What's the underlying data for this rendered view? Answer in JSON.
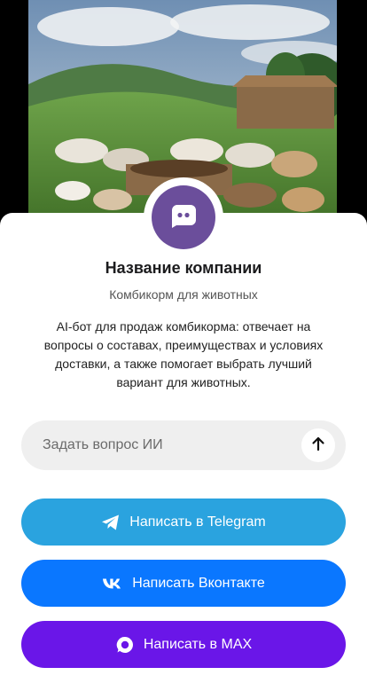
{
  "company": {
    "name": "Название компании",
    "subtitle": "Комбикорм для животных",
    "description": "AI-бот для продаж комбикорма: отвечает на вопросы о составах, преимуществах и условиях доставки, а также помогает выбрать лучший вариант для животных."
  },
  "ask": {
    "placeholder": "Задать вопрос ИИ"
  },
  "buttons": {
    "telegram": "Написать в Telegram",
    "vk": "Написать Вконтакте",
    "max": "Написать в MAX"
  },
  "colors": {
    "avatar": "#6b4e9b",
    "telegram": "#2aa3df",
    "vk": "#0a77ff",
    "max": "#6a16e8",
    "input_bg": "#efefef"
  },
  "icons": {
    "avatar": "chat-bubble-icon",
    "send": "arrow-up-icon",
    "telegram": "telegram-icon",
    "vk": "vk-icon",
    "max": "max-icon"
  }
}
